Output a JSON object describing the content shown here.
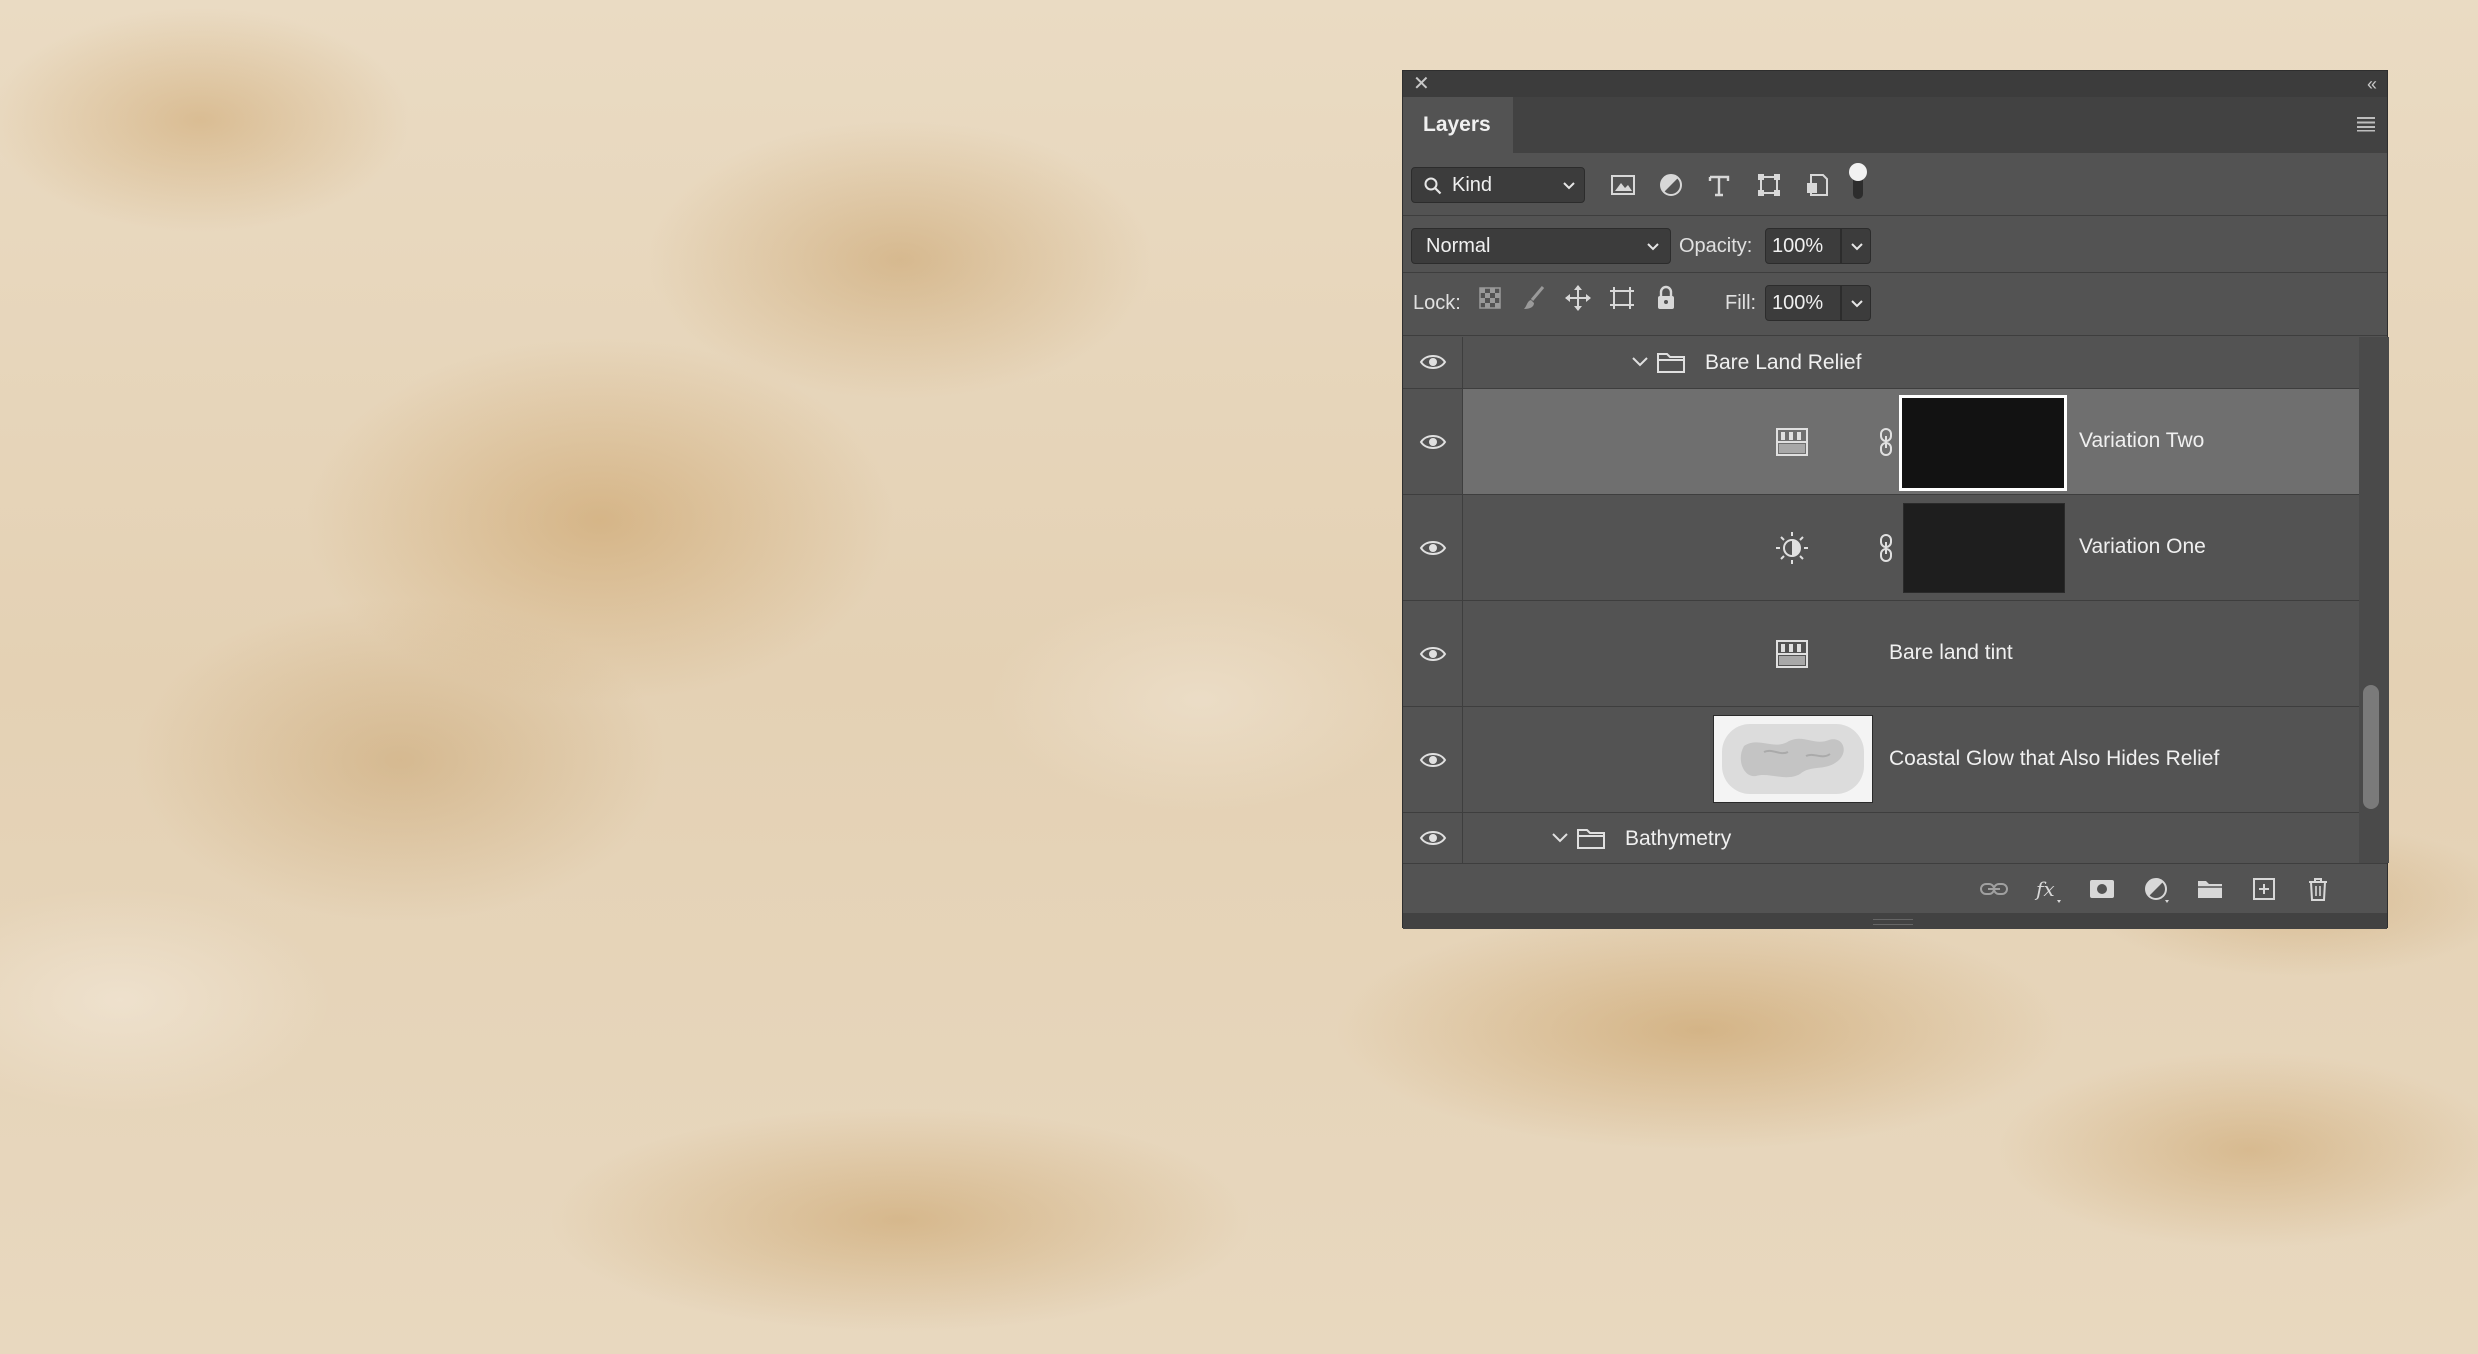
{
  "panel": {
    "tab_label": "Layers",
    "close_icon": "close-icon",
    "collapse_icon": "collapse-icon",
    "menu_icon": "panel-menu-icon"
  },
  "filter": {
    "kind_label": "Kind",
    "icons": [
      "pixel-layer-filter-icon",
      "adjustment-layer-filter-icon",
      "type-layer-filter-icon",
      "shape-layer-filter-icon",
      "smart-object-filter-icon"
    ],
    "filter_toggle_on": true
  },
  "blend": {
    "mode": "Normal",
    "opacity_label": "Opacity:",
    "opacity_value": "100%"
  },
  "lock": {
    "label": "Lock:",
    "icons": [
      "lock-transparent-pixels-icon",
      "lock-image-pixels-icon",
      "lock-position-icon",
      "lock-artboard-icon",
      "lock-all-icon"
    ],
    "fill_label": "Fill:",
    "fill_value": "100%"
  },
  "layers": [
    {
      "name": "Bare Land Relief",
      "type": "group",
      "expanded": true,
      "visible": true
    },
    {
      "name": "Variation Two",
      "type": "gradient-map-adjustment",
      "has_mask": true,
      "selected": true,
      "visible": true
    },
    {
      "name": "Variation One",
      "type": "brightness-contrast-adjustment",
      "has_mask": true,
      "selected": false,
      "visible": true
    },
    {
      "name": "Bare land tint",
      "type": "gradient-map-adjustment",
      "has_mask": false,
      "visible": true
    },
    {
      "name": "Coastal Glow that Also Hides Relief",
      "type": "pixel",
      "visible": true
    },
    {
      "name": "Bathymetry",
      "type": "group",
      "expanded": true,
      "visible": true
    }
  ],
  "bottom_icons": [
    "link-layers-icon",
    "fx-icon",
    "add-mask-icon",
    "new-adjustment-layer-icon",
    "new-group-icon",
    "new-layer-icon",
    "delete-layer-icon"
  ],
  "colors": {
    "panel_bg": "#535353",
    "selected_row": "#6f6f6f",
    "canvas": "#e6d4b8"
  }
}
